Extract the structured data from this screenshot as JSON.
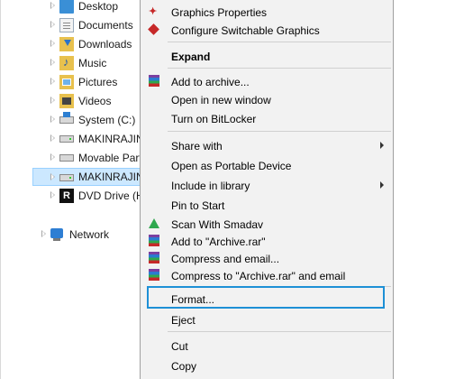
{
  "tree": {
    "items": [
      {
        "label": "Desktop",
        "icon": "desktop-folder-icon"
      },
      {
        "label": "Documents",
        "icon": "documents-folder-icon"
      },
      {
        "label": "Downloads",
        "icon": "downloads-folder-icon"
      },
      {
        "label": "Music",
        "icon": "music-folder-icon"
      },
      {
        "label": "Pictures",
        "icon": "pictures-folder-icon"
      },
      {
        "label": "Videos",
        "icon": "videos-folder-icon"
      },
      {
        "label": "System (C:)",
        "icon": "system-drive-icon"
      },
      {
        "label": "MAKINRAJIN",
        "icon": "drive-icon"
      },
      {
        "label": "Movable Part",
        "icon": "drive-icon"
      },
      {
        "label": "MAKINRAJIN",
        "icon": "drive-icon",
        "selected": true
      },
      {
        "label": "DVD Drive (H",
        "icon": "dvd-drive-icon"
      }
    ],
    "network": {
      "label": "Network",
      "icon": "network-icon"
    }
  },
  "menu": {
    "graphics_properties": "Graphics Properties",
    "configure_switchable": "Configure Switchable Graphics",
    "expand": "Expand",
    "add_to_archive": "Add to archive...",
    "open_new_window": "Open in new window",
    "turn_on_bitlocker": "Turn on BitLocker",
    "share_with": "Share with",
    "open_portable": "Open as Portable Device",
    "include_library": "Include in library",
    "pin_to_start": "Pin to Start",
    "scan_smadav": "Scan With Smadav",
    "add_to_archive_rar": "Add to \"Archive.rar\"",
    "compress_email": "Compress and email...",
    "compress_rar_email": "Compress to \"Archive.rar\" and email",
    "format": "Format...",
    "eject": "Eject",
    "cut": "Cut",
    "copy": "Copy"
  },
  "colors": {
    "menu_background": "#f2f2f2",
    "highlight_border": "#1e90d6",
    "selected_tree_item": "#cce8ff"
  }
}
